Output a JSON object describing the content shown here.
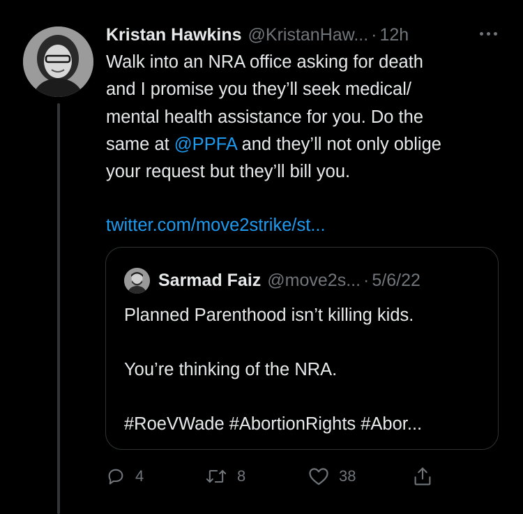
{
  "tweet": {
    "author_name": "Kristan Hawkins",
    "author_handle": "@KristanHaw...",
    "separator": "·",
    "time": "12h",
    "text_lines": [
      "Walk into an NRA office asking for death",
      "and I promise you they’ll seek medical/",
      "mental health assistance for you. Do the"
    ],
    "line4_pre": "same at ",
    "mention": "@PPFA",
    "line4_post": " and they’ll not only oblige",
    "line5": "your request but they’ll bill you.",
    "link": "twitter.com/move2strike/st..."
  },
  "quote": {
    "author_name": "Sarmad Faiz",
    "author_handle": "@move2s...",
    "separator": "·",
    "date": "5/6/22",
    "line1": "Planned Parenthood isn’t killing kids.",
    "line2": "You’re thinking of the NRA.",
    "line3": "#RoeVWade #AbortionRights #Abor..."
  },
  "actions": {
    "reply_count": "4",
    "retweet_count": "8",
    "like_count": "38"
  },
  "colors": {
    "background": "#000000",
    "text": "#e7e9ea",
    "secondary": "#71767b",
    "link": "#1d9bf0",
    "border": "#2f3336"
  },
  "icons": [
    "more-icon",
    "reply-icon",
    "retweet-icon",
    "like-icon",
    "share-icon"
  ]
}
